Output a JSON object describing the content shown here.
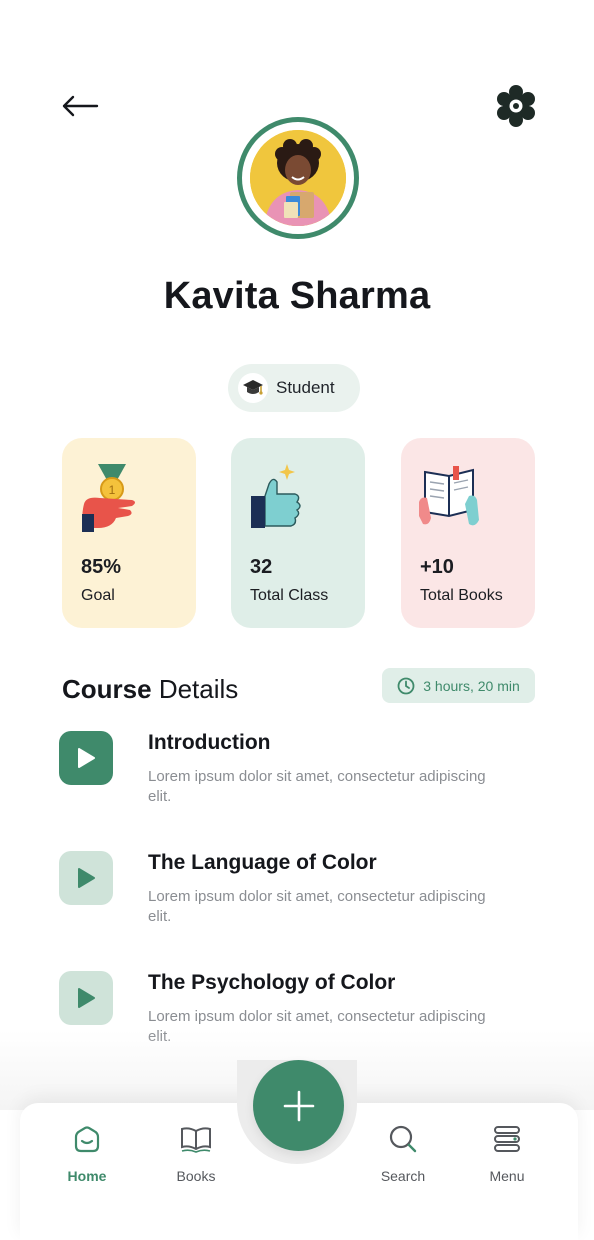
{
  "header": {
    "back_icon": "arrow-left-icon",
    "settings_icon": "gear-icon"
  },
  "profile": {
    "name": "Kavita Sharma",
    "role": "Student",
    "role_icon": "graduation-cap-icon"
  },
  "stats": [
    {
      "value": "85%",
      "label": "Goal",
      "icon": "medal-hand-icon",
      "bg": "#fdf2d5"
    },
    {
      "value": "32",
      "label": "Total Class",
      "icon": "thumbs-up-icon",
      "bg": "#dfeee8"
    },
    {
      "value": "+10",
      "label": "Total Books",
      "icon": "open-book-icon",
      "bg": "#fbe6e6"
    }
  ],
  "course": {
    "title_bold": "Course",
    "title_rest": "Details",
    "duration": "3 hours, 20 min",
    "lessons": [
      {
        "title": "Introduction",
        "desc": "Lorem ipsum dolor sit amet, consectetur adipiscing elit.",
        "active": true
      },
      {
        "title": "The Language of Color",
        "desc": "Lorem ipsum dolor sit amet, consectetur adipiscing elit.",
        "active": false
      },
      {
        "title": "The Psychology of Color",
        "desc": "Lorem ipsum dolor sit amet, consectetur adipiscing elit.",
        "active": false
      }
    ]
  },
  "nav": {
    "items": [
      {
        "label": "Home",
        "icon": "home-icon",
        "active": true
      },
      {
        "label": "Books",
        "icon": "book-icon",
        "active": false
      },
      {
        "label": "Search",
        "icon": "search-icon",
        "active": false
      },
      {
        "label": "Menu",
        "icon": "menu-icon",
        "active": false
      }
    ],
    "fab_icon": "plus-icon"
  },
  "colors": {
    "accent": "#3f8a6b",
    "accent_light": "#cfe3d9",
    "goal_bg": "#fdf2d5",
    "class_bg": "#dfeee8",
    "books_bg": "#fbe6e6"
  }
}
